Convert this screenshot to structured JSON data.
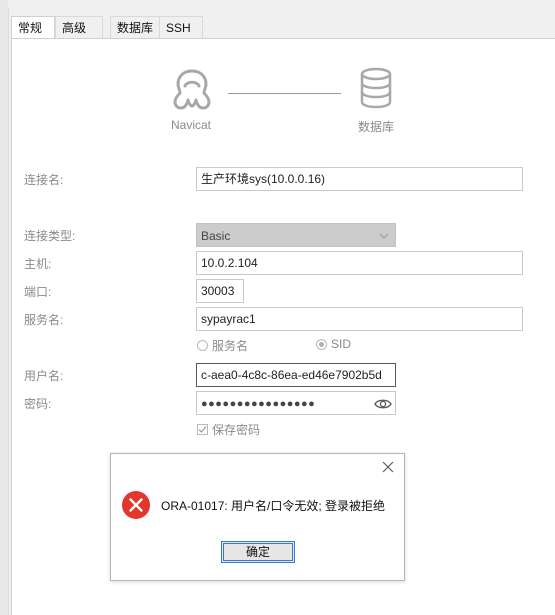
{
  "tabs": [
    {
      "label": "常规",
      "active": true
    },
    {
      "label": "高级",
      "active": false
    },
    {
      "label": "数据库",
      "active": false
    },
    {
      "label": "SSH",
      "active": false
    }
  ],
  "header": {
    "left_caption": "Navicat",
    "right_caption": "数据库"
  },
  "form": {
    "connection_name": {
      "label": "连接名:",
      "value": "生产环境sys(10.0.0.16)"
    },
    "connection_type": {
      "label": "连接类型:",
      "value": "Basic"
    },
    "host": {
      "label": "主机:",
      "value": "10.0.2.104"
    },
    "port": {
      "label": "端口:",
      "value": "30003"
    },
    "service_name": {
      "label": "服务名:",
      "value": "sypayrac1"
    },
    "service_radio": {
      "label": "服务名",
      "checked": false
    },
    "sid_radio": {
      "label": "SID",
      "checked": true
    },
    "username": {
      "label": "用户名:",
      "value": "c-aea0-4c8c-86ea-ed46e7902b5d"
    },
    "password": {
      "label": "密码:",
      "value": "●●●●●●●●●●●●●●●●"
    },
    "save_password": {
      "label": "保存密码",
      "checked": true
    }
  },
  "dialog": {
    "message": "ORA-01017: 用户名/口令无效; 登录被拒绝",
    "ok_label": "确定"
  },
  "colors": {
    "error_red": "#e2382b",
    "button_focus": "#3a78d8",
    "label_gray": "#8a8a8a"
  },
  "icons": {
    "navicat": "navicat-logo-icon",
    "database": "database-icon",
    "eye": "eye-icon",
    "close": "close-icon",
    "error": "error-icon",
    "chevron": "chevron-down-icon"
  }
}
